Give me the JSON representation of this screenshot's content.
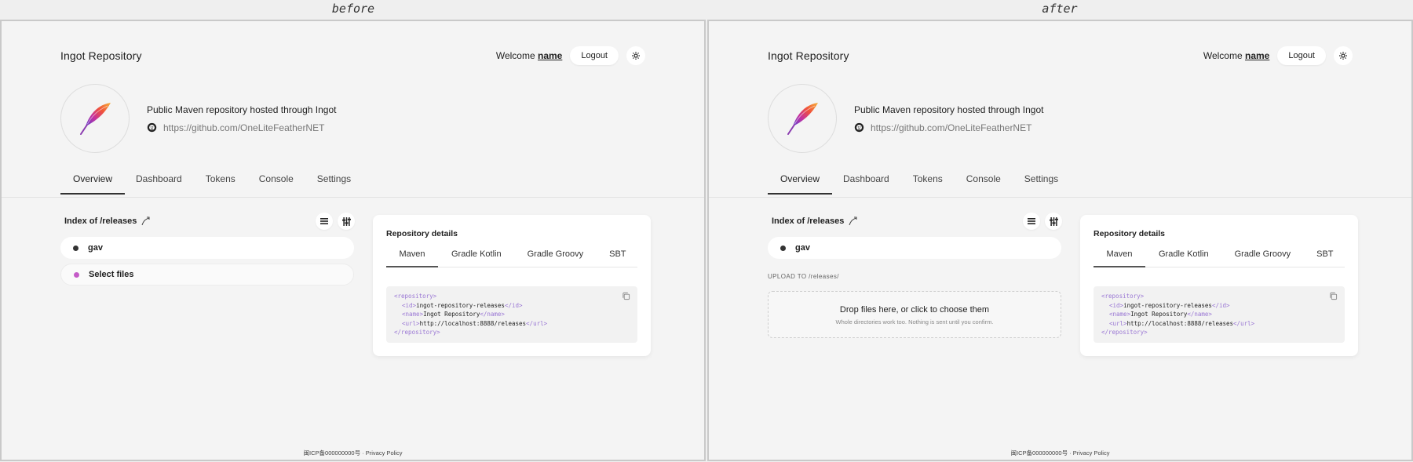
{
  "captions": {
    "before": "before",
    "after": "after"
  },
  "app": {
    "brand": "Ingot Repository",
    "welcome_prefix": "Welcome",
    "welcome_name": "name",
    "logout_label": "Logout"
  },
  "profile": {
    "description": "Public Maven repository hosted through Ingot",
    "link": "https://github.com/OneLiteFeatherNET"
  },
  "tabs": [
    "Overview",
    "Dashboard",
    "Tokens",
    "Console",
    "Settings"
  ],
  "index": {
    "title": "Index of /releases",
    "items": {
      "gav": "gav",
      "select_files": "Select files"
    }
  },
  "upload": {
    "label": "UPLOAD TO /releases/",
    "title": "Drop files here, or click to choose them",
    "subtitle": "Whole directories work too. Nothing is sent until you confirm."
  },
  "details": {
    "title": "Repository details",
    "tabs": [
      "Maven",
      "Gradle Kotlin",
      "Gradle Groovy",
      "SBT"
    ],
    "code": {
      "open_repo": "<repository>",
      "id_open": "<id>",
      "id_value": "ingot-repository-releases",
      "id_close": "</id>",
      "name_open": "<name>",
      "name_value": "Ingot Repository",
      "name_close": "</name>",
      "url_open": "<url>",
      "url_value": "http://localhost:8888/releases",
      "url_close": "</url>",
      "close_repo": "</repository>"
    }
  },
  "footer": {
    "icp": "闽ICP备000000000号",
    "sep": "·",
    "privacy": "Privacy Policy"
  },
  "colors": {
    "accent_purple": "#c55cc8",
    "code_tag": "#9a77d4"
  }
}
